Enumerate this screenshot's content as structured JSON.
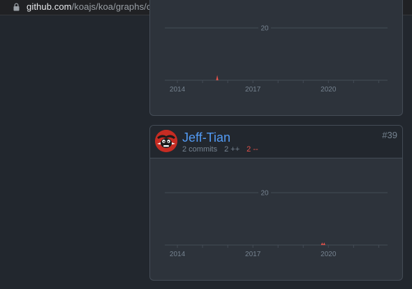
{
  "browser": {
    "url_host": "github.com",
    "url_path": "/koajs/koa/graphs/contributors"
  },
  "contributors": [
    {
      "chart_data": {
        "type": "area",
        "y_gridline": 20,
        "y_label": "20",
        "x_ticks": [
          "2014",
          "2017",
          "2020"
        ],
        "x": [
          "2015-08"
        ],
        "values": [
          2
        ],
        "color": "#e5534b"
      }
    },
    {
      "name": "Jeff-Tian",
      "commits": "2 commits",
      "additions": "2 ++",
      "deletions": "2 --",
      "rank": "#39",
      "chart_data": {
        "type": "area",
        "y_gridline": 20,
        "y_label": "20",
        "x_ticks": [
          "2014",
          "2017",
          "2020"
        ],
        "x": [
          "2019-10",
          "2019-11"
        ],
        "values": [
          1,
          1
        ],
        "color": "#e5534b"
      }
    }
  ],
  "colors": {
    "page_bg": "#22272e",
    "card_bg": "#2d333b",
    "border": "#444c56",
    "link": "#539bf5",
    "muted": "#768390",
    "deletions": "#e5534b"
  }
}
